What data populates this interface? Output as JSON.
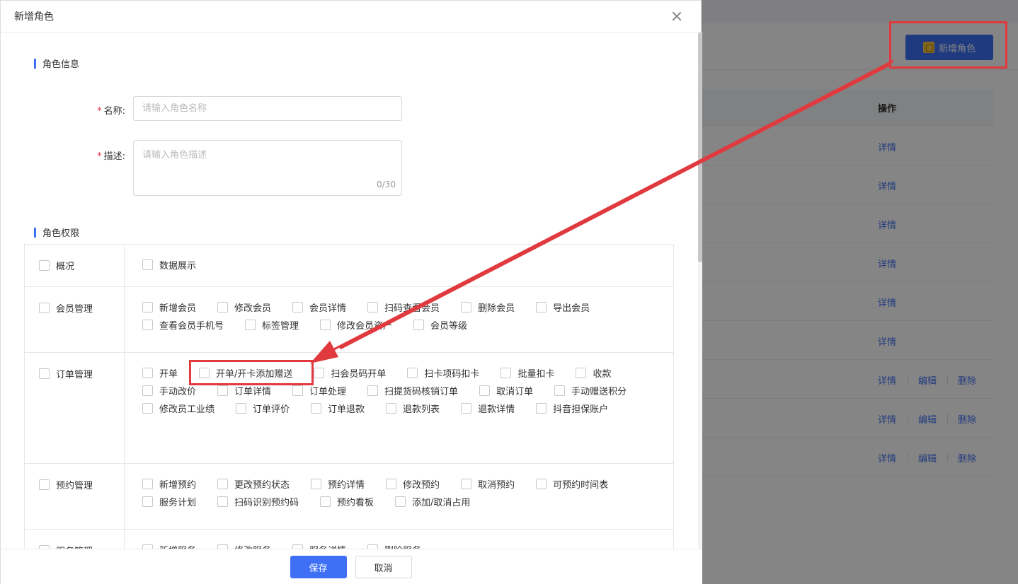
{
  "background": {
    "add_role_button": "新增角色",
    "table_header_ops": "操作",
    "rows": [
      {
        "links": [
          "详情"
        ]
      },
      {
        "links": [
          "详情"
        ]
      },
      {
        "links": [
          "详情"
        ]
      },
      {
        "links": [
          "详情"
        ]
      },
      {
        "links": [
          "详情"
        ]
      },
      {
        "links": [
          "详情"
        ]
      },
      {
        "links": [
          "详情",
          "编辑",
          "删除"
        ]
      },
      {
        "links": [
          "详情",
          "编辑",
          "删除"
        ]
      },
      {
        "links": [
          "详情",
          "编辑",
          "删除"
        ]
      }
    ]
  },
  "drawer": {
    "title": "新增角色",
    "section_info": "角色信息",
    "name_label": "名称:",
    "name_placeholder": "请输入角色名称",
    "desc_label": "描述:",
    "desc_placeholder": "请输入角色描述",
    "desc_counter": "0/30",
    "section_perm": "角色权限",
    "permissions": [
      {
        "category": "概况",
        "items": [
          "数据展示"
        ]
      },
      {
        "category": "会员管理",
        "items": [
          "新增会员",
          "修改会员",
          "会员详情",
          "扫码查看会员",
          "删除会员",
          "导出会员",
          "查看会员手机号",
          "标签管理",
          "修改会员资产",
          "会员等级"
        ]
      },
      {
        "category": "订单管理",
        "items": [
          "开单",
          "开单/开卡添加赠送",
          "扫会员码开单",
          "扫卡项码扣卡",
          "批量扣卡",
          "收款",
          "手动改价",
          "订单详情",
          "订单处理",
          "扫提货码核销订单",
          "取消订单",
          "手动赠送积分",
          "修改员工业绩",
          "订单评价",
          "订单退款",
          "退款列表",
          "退款详情",
          "抖音担保账户"
        ]
      },
      {
        "category": "预约管理",
        "items": [
          "新增预约",
          "更改预约状态",
          "预约详情",
          "修改预约",
          "取消预约",
          "可预约时间表",
          "服务计划",
          "扫码识别预约码",
          "预约看板",
          "添加/取消占用"
        ]
      },
      {
        "category": "服务管理",
        "items": [
          "新增服务",
          "修改服务",
          "服务详情",
          "删除服务"
        ]
      }
    ],
    "save_button": "保存",
    "cancel_button": "取消"
  },
  "colors": {
    "accent": "#3f6ff4",
    "annotation": "#e0393e",
    "required": "#e34"
  }
}
